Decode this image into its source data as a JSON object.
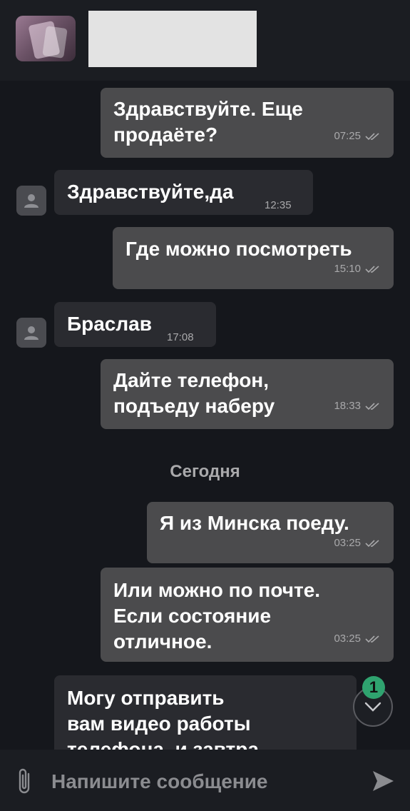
{
  "header": {
    "contact_name_redacted": ""
  },
  "messages": [
    {
      "dir": "out",
      "lines": [
        "Здравствуйте. Еще",
        "продаёте?"
      ],
      "time": "07:25",
      "read": true
    },
    {
      "dir": "in",
      "lines": [
        "Здравствуйте,да"
      ],
      "time": "12:35"
    },
    {
      "dir": "out",
      "lines": [
        "Где можно посмотреть"
      ],
      "time": "15:10",
      "read": true
    },
    {
      "dir": "in",
      "lines": [
        "Браслав"
      ],
      "time": "17:08"
    },
    {
      "dir": "out",
      "lines": [
        "Дайте телефон,",
        "подъеду наберу"
      ],
      "time": "18:33",
      "read": true
    },
    {
      "dir": "out",
      "lines": [
        "Я из Минска поеду."
      ],
      "time": "03:25",
      "read": true
    },
    {
      "dir": "out",
      "lines": [
        "Или можно по почте.",
        "Если состояние",
        "отличное."
      ],
      "time": "03:25",
      "read": true
    },
    {
      "dir": "in",
      "lines": [
        "Могу отправить",
        "вам видео работы",
        "телефона, и завтра"
      ],
      "time": ""
    }
  ],
  "date_separator": "Сегодня",
  "unread_count": "1",
  "composer": {
    "placeholder": "Напишите сообщение"
  },
  "colors": {
    "background": "#15171c",
    "outgoing_bubble": "#4b4b4d",
    "incoming_bubble": "#2a2b30",
    "badge": "#2fa36f"
  }
}
